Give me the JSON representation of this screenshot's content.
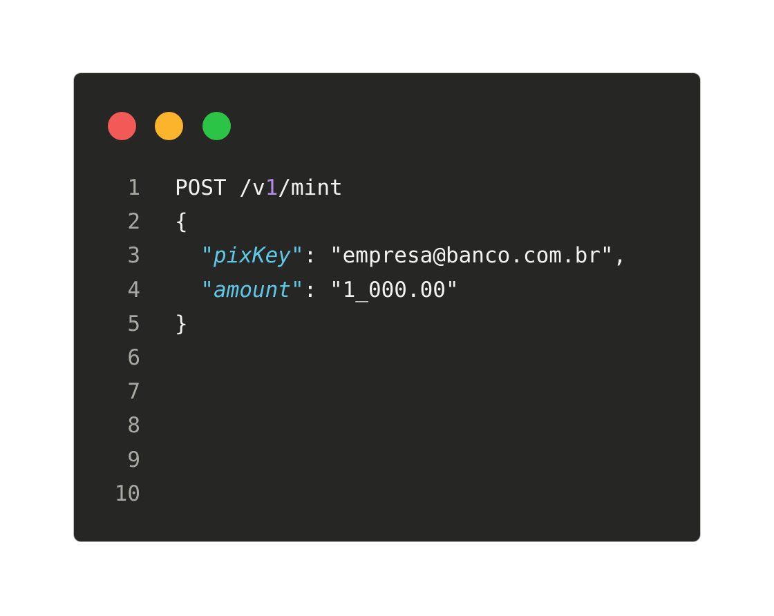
{
  "window": {
    "buttons": [
      {
        "name": "close",
        "color": "#f25a57"
      },
      {
        "name": "minimize",
        "color": "#fbb42b"
      },
      {
        "name": "maximize",
        "color": "#2bc447"
      }
    ]
  },
  "colors": {
    "background": "#262624",
    "text": "#f2f2ee",
    "line_number": "#a9a9a4",
    "key": "#5ec8e6",
    "number_highlight": "#b38be8"
  },
  "code": {
    "line_numbers": [
      "1",
      "2",
      "3",
      "4",
      "5",
      "6",
      "7",
      "8",
      "9",
      "10"
    ],
    "lines": [
      {
        "tokens": [
          {
            "text": "POST /v",
            "kind": "plain"
          },
          {
            "text": "1",
            "kind": "number"
          },
          {
            "text": "/mint",
            "kind": "plain"
          }
        ]
      },
      {
        "tokens": [
          {
            "text": "{",
            "kind": "plain"
          }
        ]
      },
      {
        "tokens": [
          {
            "text": "  ",
            "kind": "plain"
          },
          {
            "text": "\"pixKey\"",
            "kind": "key"
          },
          {
            "text": ": \"empresa@banco.com.br\",",
            "kind": "plain"
          }
        ]
      },
      {
        "tokens": [
          {
            "text": "  ",
            "kind": "plain"
          },
          {
            "text": "\"amount\"",
            "kind": "key"
          },
          {
            "text": ": \"1_000.00\"",
            "kind": "plain"
          }
        ]
      },
      {
        "tokens": [
          {
            "text": "}",
            "kind": "plain"
          }
        ]
      },
      {
        "tokens": []
      },
      {
        "tokens": []
      },
      {
        "tokens": []
      },
      {
        "tokens": []
      },
      {
        "tokens": []
      }
    ]
  }
}
